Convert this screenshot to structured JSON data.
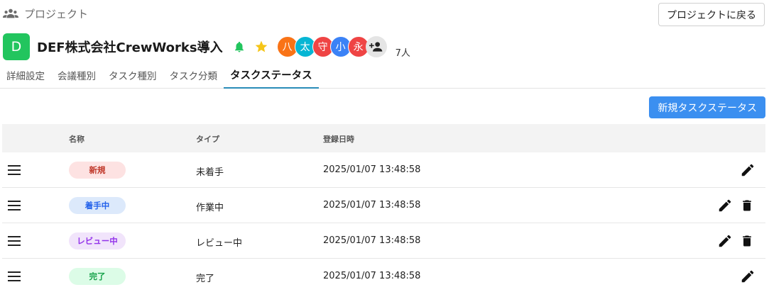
{
  "breadcrumb": {
    "label": "プロジェクト",
    "icon": "people-icon"
  },
  "back_button": {
    "label": "プロジェクトに戻る"
  },
  "project": {
    "initial": "D",
    "title": "DEF株式会社CrewWorks導入",
    "avatar_color": "#22c55e",
    "members": [
      {
        "initial": "八",
        "color": "#f97316"
      },
      {
        "initial": "太",
        "color": "#06b6d4"
      },
      {
        "initial": "守",
        "color": "#ef4444"
      },
      {
        "initial": "小",
        "color": "#3b82f6"
      },
      {
        "initial": "永",
        "color": "#ef4444"
      }
    ],
    "member_count": "7人"
  },
  "tabs": [
    {
      "label": "詳細設定"
    },
    {
      "label": "会議種別"
    },
    {
      "label": "タスク種別"
    },
    {
      "label": "タスク分類"
    },
    {
      "label": "タスクステータス",
      "active": true
    }
  ],
  "new_button": {
    "label": "新規タスクステータス"
  },
  "table": {
    "headers": {
      "name": "名称",
      "type": "タイプ",
      "created": "登録日時"
    },
    "rows": [
      {
        "name": "新規",
        "badge_bg": "#fde2e2",
        "badge_fg": "#c0392b",
        "type": "未着手",
        "created": "2025/01/07 13:48:58",
        "deletable": false
      },
      {
        "name": "着手中",
        "badge_bg": "#dce9fb",
        "badge_fg": "#2563eb",
        "type": "作業中",
        "created": "2025/01/07 13:48:58",
        "deletable": true
      },
      {
        "name": "レビュー中",
        "badge_bg": "#f1e4fb",
        "badge_fg": "#9333ea",
        "type": "レビュー中",
        "created": "2025/01/07 13:48:58",
        "deletable": true
      },
      {
        "name": "完了",
        "badge_bg": "#dcfce7",
        "badge_fg": "#16a34a",
        "type": "完了",
        "created": "2025/01/07 13:48:58",
        "deletable": false
      }
    ]
  }
}
